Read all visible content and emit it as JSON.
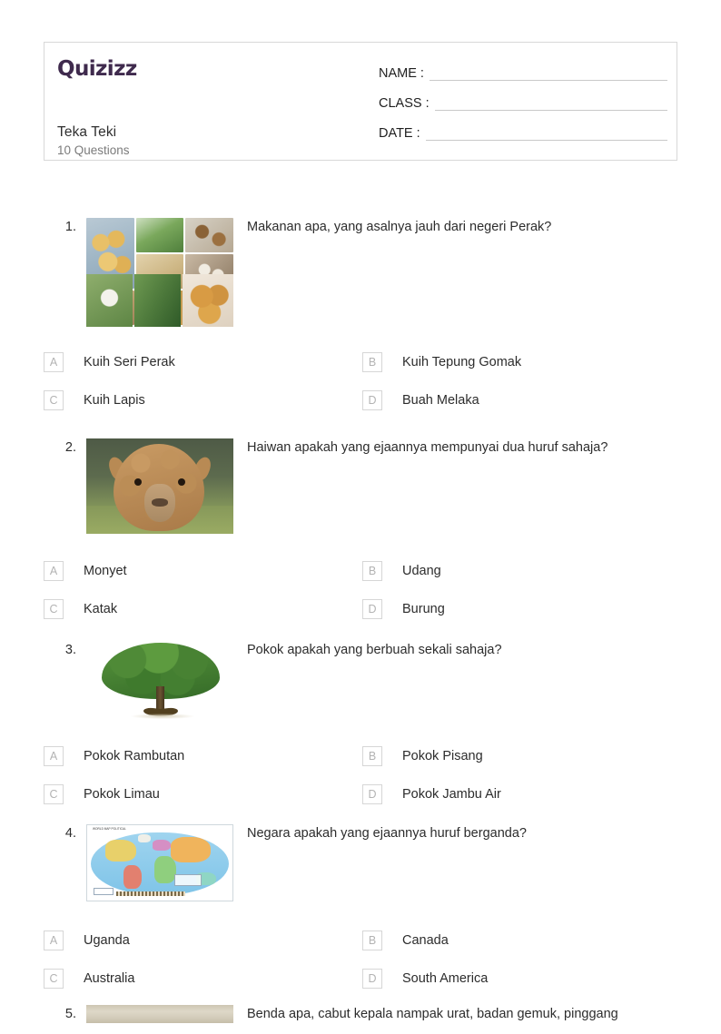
{
  "brand": {
    "logo_text": "Quizizz",
    "logo_color": "#3f2a4d"
  },
  "header": {
    "quiz_title": "Teka Teki",
    "question_count_label": "10 Questions",
    "fields": [
      {
        "label": "NAME :",
        "value": ""
      },
      {
        "label": "CLASS :",
        "value": ""
      },
      {
        "label": "DATE  :",
        "value": ""
      }
    ]
  },
  "questions": [
    {
      "number": "1.",
      "text": "Makanan apa, yang asalnya jauh dari negeri Perak?",
      "image": "kuih-collage-image",
      "options": [
        {
          "letter": "A",
          "text": "Kuih Seri Perak"
        },
        {
          "letter": "B",
          "text": "Kuih Tepung Gomak"
        },
        {
          "letter": "C",
          "text": "Kuih Lapis"
        },
        {
          "letter": "D",
          "text": "Buah Melaka"
        }
      ]
    },
    {
      "number": "2.",
      "text": "Haiwan apakah yang ejaannya mempunyai dua huruf sahaja?",
      "image": "alpaca-image",
      "options": [
        {
          "letter": "A",
          "text": "Monyet"
        },
        {
          "letter": "B",
          "text": "Udang"
        },
        {
          "letter": "C",
          "text": "Katak"
        },
        {
          "letter": "D",
          "text": "Burung"
        }
      ]
    },
    {
      "number": "3.",
      "text": "Pokok apakah yang berbuah sekali sahaja?",
      "image": "tree-image",
      "options": [
        {
          "letter": "A",
          "text": "Pokok Rambutan"
        },
        {
          "letter": "B",
          "text": "Pokok Pisang"
        },
        {
          "letter": "C",
          "text": "Pokok Limau"
        },
        {
          "letter": "D",
          "text": "Pokok Jambu Air"
        }
      ]
    },
    {
      "number": "4.",
      "text": "Negara apakah yang ejaannya huruf berganda?",
      "image": "world-political-map-image",
      "map_caption": "WORLD MAP POLITICAL",
      "options": [
        {
          "letter": "A",
          "text": "Uganda"
        },
        {
          "letter": "B",
          "text": "Canada"
        },
        {
          "letter": "C",
          "text": "Australia"
        },
        {
          "letter": "D",
          "text": "South America"
        }
      ]
    },
    {
      "number": "5.",
      "text": "Benda apa, cabut kepala nampak urat, badan gemuk, pinggang",
      "image": "stone-texture-image",
      "options": []
    }
  ]
}
